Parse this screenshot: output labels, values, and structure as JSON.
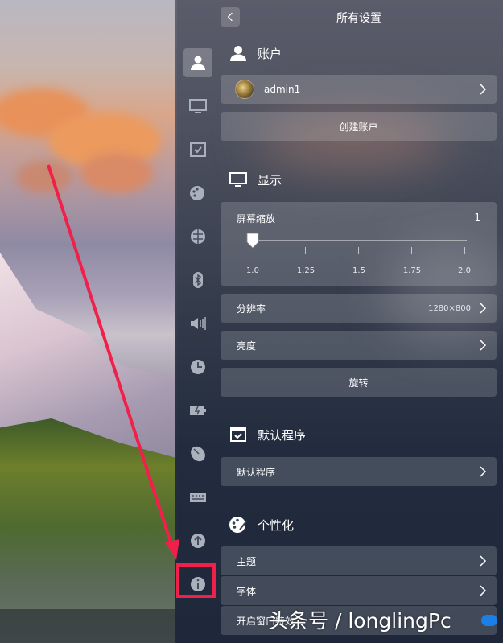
{
  "header": {
    "title": "所有设置"
  },
  "sidebar": {
    "items": [
      {
        "icon": "account-icon",
        "active": true
      },
      {
        "icon": "display-icon"
      },
      {
        "icon": "default-apps-icon"
      },
      {
        "icon": "personalization-icon"
      },
      {
        "icon": "network-icon"
      },
      {
        "icon": "bluetooth-icon"
      },
      {
        "icon": "sound-icon"
      },
      {
        "icon": "time-icon"
      },
      {
        "icon": "power-icon"
      },
      {
        "icon": "mouse-icon"
      },
      {
        "icon": "keyboard-icon"
      },
      {
        "icon": "update-icon"
      },
      {
        "icon": "system-info-icon"
      }
    ]
  },
  "account": {
    "title": "账户",
    "user_name": "admin1",
    "create_label": "创建账户"
  },
  "display": {
    "title": "显示",
    "scale_label": "屏幕缩放",
    "scale_value": "1",
    "scale_ticks": [
      "1.0",
      "1.25",
      "1.5",
      "1.75",
      "2.0"
    ],
    "scale_level": 0,
    "resolution_label": "分辨率",
    "resolution_value": "1280×800",
    "brightness_label": "亮度",
    "rotate_label": "旋转"
  },
  "default_apps": {
    "title": "默认程序",
    "row_label": "默认程序"
  },
  "personalization": {
    "title": "个性化",
    "theme_label": "主题",
    "font_label": "字体",
    "window_effect_label": "开启窗口特效"
  },
  "watermark": "头条号 / longlingPc",
  "colors": {
    "highlight": "#f0204a",
    "toggle_on": "#1a7fe6",
    "annotation_arrow": "#f0204a"
  }
}
